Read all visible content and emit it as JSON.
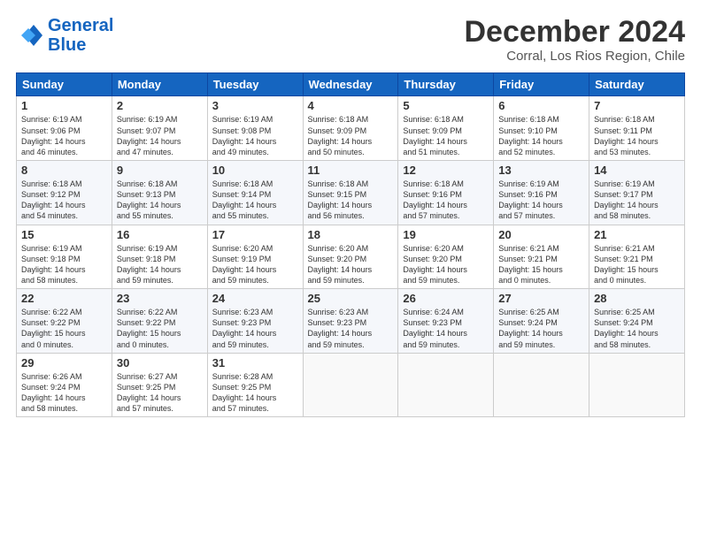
{
  "logo": {
    "line1": "General",
    "line2": "Blue"
  },
  "title": "December 2024",
  "location": "Corral, Los Rios Region, Chile",
  "days_of_week": [
    "Sunday",
    "Monday",
    "Tuesday",
    "Wednesday",
    "Thursday",
    "Friday",
    "Saturday"
  ],
  "weeks": [
    [
      {
        "day": 1,
        "sunrise": "6:19 AM",
        "sunset": "9:06 PM",
        "daylight": "14 hours and 46 minutes."
      },
      {
        "day": 2,
        "sunrise": "6:19 AM",
        "sunset": "9:07 PM",
        "daylight": "14 hours and 47 minutes."
      },
      {
        "day": 3,
        "sunrise": "6:19 AM",
        "sunset": "9:08 PM",
        "daylight": "14 hours and 49 minutes."
      },
      {
        "day": 4,
        "sunrise": "6:18 AM",
        "sunset": "9:09 PM",
        "daylight": "14 hours and 50 minutes."
      },
      {
        "day": 5,
        "sunrise": "6:18 AM",
        "sunset": "9:09 PM",
        "daylight": "14 hours and 51 minutes."
      },
      {
        "day": 6,
        "sunrise": "6:18 AM",
        "sunset": "9:10 PM",
        "daylight": "14 hours and 52 minutes."
      },
      {
        "day": 7,
        "sunrise": "6:18 AM",
        "sunset": "9:11 PM",
        "daylight": "14 hours and 53 minutes."
      }
    ],
    [
      {
        "day": 8,
        "sunrise": "6:18 AM",
        "sunset": "9:12 PM",
        "daylight": "14 hours and 54 minutes."
      },
      {
        "day": 9,
        "sunrise": "6:18 AM",
        "sunset": "9:13 PM",
        "daylight": "14 hours and 55 minutes."
      },
      {
        "day": 10,
        "sunrise": "6:18 AM",
        "sunset": "9:14 PM",
        "daylight": "14 hours and 55 minutes."
      },
      {
        "day": 11,
        "sunrise": "6:18 AM",
        "sunset": "9:15 PM",
        "daylight": "14 hours and 56 minutes."
      },
      {
        "day": 12,
        "sunrise": "6:18 AM",
        "sunset": "9:16 PM",
        "daylight": "14 hours and 57 minutes."
      },
      {
        "day": 13,
        "sunrise": "6:19 AM",
        "sunset": "9:16 PM",
        "daylight": "14 hours and 57 minutes."
      },
      {
        "day": 14,
        "sunrise": "6:19 AM",
        "sunset": "9:17 PM",
        "daylight": "14 hours and 58 minutes."
      }
    ],
    [
      {
        "day": 15,
        "sunrise": "6:19 AM",
        "sunset": "9:18 PM",
        "daylight": "14 hours and 58 minutes."
      },
      {
        "day": 16,
        "sunrise": "6:19 AM",
        "sunset": "9:18 PM",
        "daylight": "14 hours and 59 minutes."
      },
      {
        "day": 17,
        "sunrise": "6:20 AM",
        "sunset": "9:19 PM",
        "daylight": "14 hours and 59 minutes."
      },
      {
        "day": 18,
        "sunrise": "6:20 AM",
        "sunset": "9:20 PM",
        "daylight": "14 hours and 59 minutes."
      },
      {
        "day": 19,
        "sunrise": "6:20 AM",
        "sunset": "9:20 PM",
        "daylight": "14 hours and 59 minutes."
      },
      {
        "day": 20,
        "sunrise": "6:21 AM",
        "sunset": "9:21 PM",
        "daylight": "15 hours and 0 minutes."
      },
      {
        "day": 21,
        "sunrise": "6:21 AM",
        "sunset": "9:21 PM",
        "daylight": "15 hours and 0 minutes."
      }
    ],
    [
      {
        "day": 22,
        "sunrise": "6:22 AM",
        "sunset": "9:22 PM",
        "daylight": "15 hours and 0 minutes."
      },
      {
        "day": 23,
        "sunrise": "6:22 AM",
        "sunset": "9:22 PM",
        "daylight": "15 hours and 0 minutes."
      },
      {
        "day": 24,
        "sunrise": "6:23 AM",
        "sunset": "9:23 PM",
        "daylight": "14 hours and 59 minutes."
      },
      {
        "day": 25,
        "sunrise": "6:23 AM",
        "sunset": "9:23 PM",
        "daylight": "14 hours and 59 minutes."
      },
      {
        "day": 26,
        "sunrise": "6:24 AM",
        "sunset": "9:23 PM",
        "daylight": "14 hours and 59 minutes."
      },
      {
        "day": 27,
        "sunrise": "6:25 AM",
        "sunset": "9:24 PM",
        "daylight": "14 hours and 59 minutes."
      },
      {
        "day": 28,
        "sunrise": "6:25 AM",
        "sunset": "9:24 PM",
        "daylight": "14 hours and 58 minutes."
      }
    ],
    [
      {
        "day": 29,
        "sunrise": "6:26 AM",
        "sunset": "9:24 PM",
        "daylight": "14 hours and 58 minutes."
      },
      {
        "day": 30,
        "sunrise": "6:27 AM",
        "sunset": "9:25 PM",
        "daylight": "14 hours and 57 minutes."
      },
      {
        "day": 31,
        "sunrise": "6:28 AM",
        "sunset": "9:25 PM",
        "daylight": "14 hours and 57 minutes."
      },
      null,
      null,
      null,
      null
    ]
  ]
}
